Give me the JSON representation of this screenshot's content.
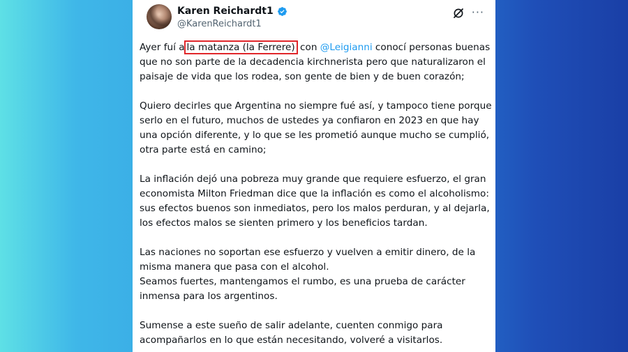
{
  "author": {
    "display_name": "Karen Reichardt1",
    "handle": "@KarenReichardt1"
  },
  "icons": {
    "verified": "verified-badge-icon",
    "grok": "grok-icon",
    "more": "more-options-icon"
  },
  "colors": {
    "highlight_border": "#e0262a",
    "mention": "#1d9bf0",
    "verified": "#1d9bf0"
  },
  "tweet": {
    "p1_before": "Ayer fuí a",
    "p1_highlight": "la matanza (la Ferrere)",
    "p1_mid": " con ",
    "p1_mention": "@Leigianni",
    "p1_after": " conocí personas buenas que no son parte de la decadencia kirchnerista pero que naturalizaron el paisaje de vida que los rodea, son gente de bien y de buen corazón;",
    "p2": "Quiero decirles que Argentina no siempre fué así, y tampoco tiene porque serlo en el futuro, muchos de ustedes ya confiaron en 2023 en que hay una opción diferente, y lo que se les prometió aunque mucho se cumplió, otra parte está en camino;",
    "p3": "La inflación dejó una pobreza muy grande que requiere esfuerzo, el gran economista Milton Friedman dice que la inflación es como el alcoholismo: sus efectos buenos son inmediatos, pero los malos perduran, y al dejarla, los efectos malos se sienten primero y los beneficios tardan.",
    "p4a": "Las naciones no soportan ese esfuerzo y vuelven a emitir dinero, de la misma manera que pasa con el alcohol.",
    "p4b": "Seamos fuertes, mantengamos el rumbo, es una prueba de carácter inmensa para los argentinos.",
    "p5": "Sumense a este sueño de salir adelante, cuenten conmigo para acompañarlos en lo que están necesitando, volveré a visitarlos."
  }
}
